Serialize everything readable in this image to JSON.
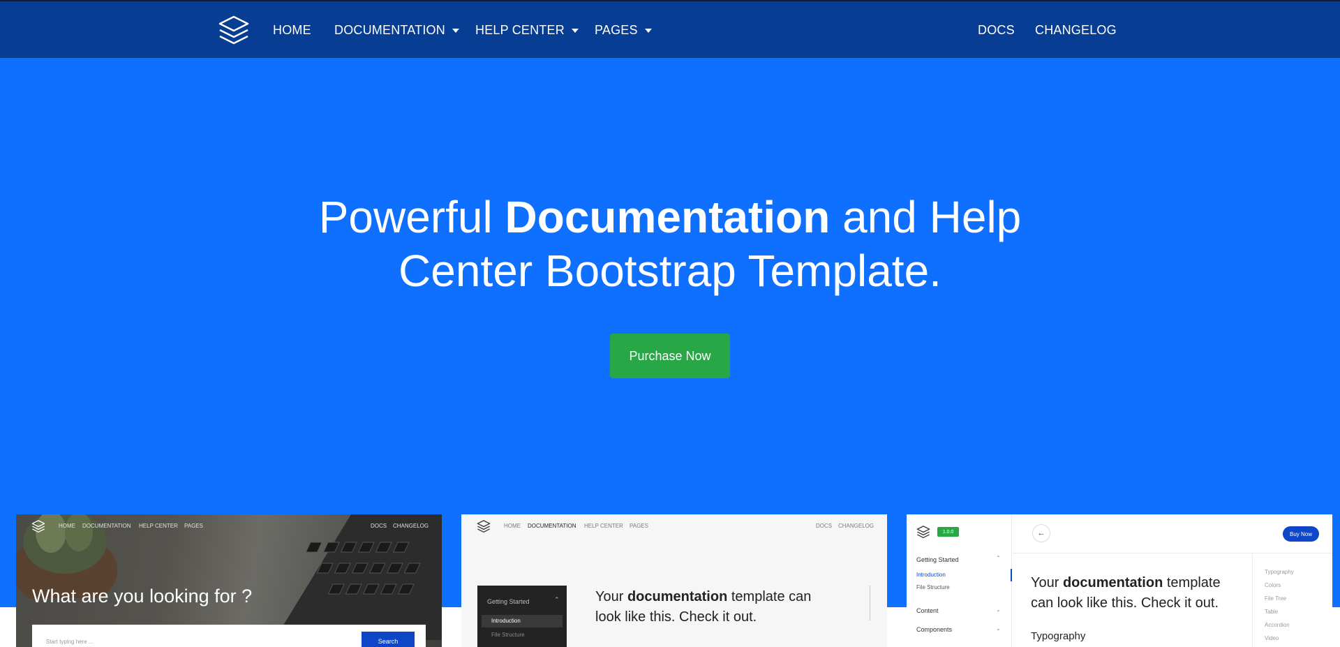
{
  "navbar": {
    "left_items": [
      {
        "label": "HOME",
        "dropdown": false
      },
      {
        "label": "DOCUMENTATION",
        "dropdown": true
      },
      {
        "label": "HELP CENTER",
        "dropdown": true
      },
      {
        "label": "PAGES",
        "dropdown": true
      }
    ],
    "right_items": [
      {
        "label": "DOCS"
      },
      {
        "label": "CHANGELOG"
      }
    ],
    "logo_icon": "layers-icon"
  },
  "hero": {
    "title_part1": "Powerful ",
    "title_bold": "Documentation",
    "title_part2": " and Help Center Bootstrap Template.",
    "cta_label": "Purchase Now"
  },
  "previews": {
    "help_center": {
      "nav_left": [
        "HOME",
        "DOCUMENTATION",
        "HELP CENTER",
        "PAGES"
      ],
      "nav_right": [
        "DOCS",
        "CHANGELOG"
      ],
      "heading": "What are you looking for ?",
      "search_placeholder": "Start typing here ...",
      "search_button": "Search"
    },
    "documentation": {
      "nav_left": [
        "HOME",
        "DOCUMENTATION",
        "HELP CENTER",
        "PAGES"
      ],
      "nav_right": [
        "DOCS",
        "CHANGELOG"
      ],
      "sidebar_section": "Getting Started",
      "sidebar_items": [
        "Introduction",
        "File Structure"
      ],
      "text_part1": "Your ",
      "text_bold": "documentation",
      "text_part2": " template can look like this. Check it out."
    },
    "docs_app": {
      "version_badge": "1.0.0",
      "sidebar_section": "Getting Started",
      "sidebar_items": [
        "Introduction",
        "File Structure"
      ],
      "sidebar_groups": [
        "Content",
        "Components"
      ],
      "buy_button": "Buy Now",
      "text_part1": "Your ",
      "text_bold": "documentation",
      "text_part2": " template can look like this. Check it out.",
      "subheading": "Typography",
      "toc": [
        "Typography",
        "Colors",
        "File Tree",
        "Table",
        "Accordion",
        "Video"
      ]
    }
  },
  "colors": {
    "navbar": "#073d92",
    "hero": "#0f6ffe",
    "cta": "#27a745"
  }
}
